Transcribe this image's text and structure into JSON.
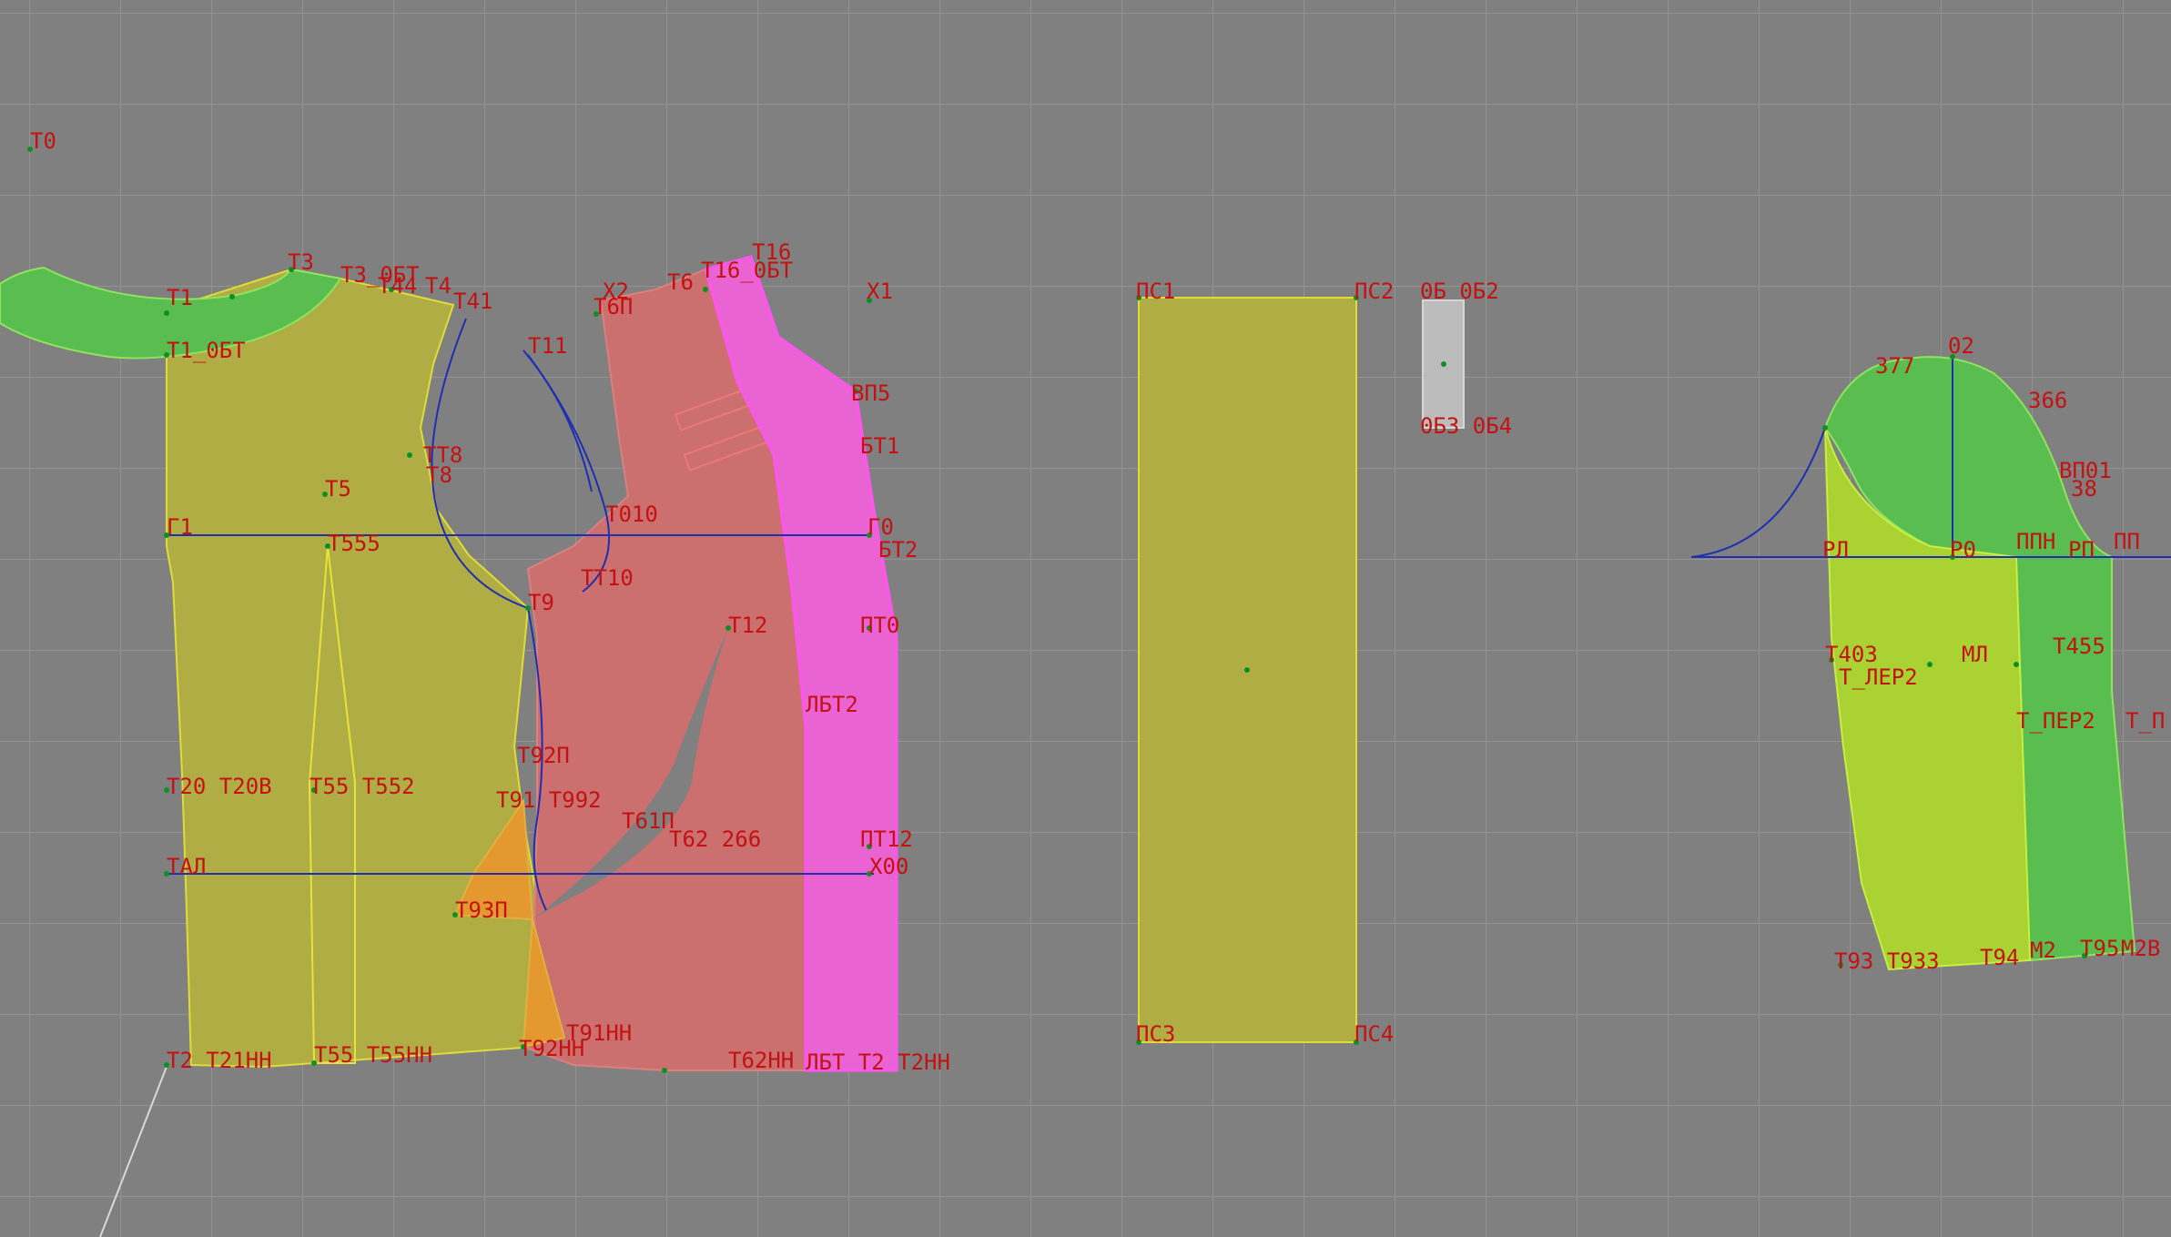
{
  "colors": {
    "background": "#808080",
    "grid": "#939393",
    "label": "#c41111",
    "point": "#0e8f24",
    "construction_line": "#1f2fb0",
    "olive_piece": "#b1ad45",
    "olive_piece_edge": "#dedc39",
    "green_piece": "#59bd4f",
    "green_piece_edge": "#8fe35f",
    "salmon_piece": "#cb6f6f",
    "magenta_piece": "#e964d2",
    "magenta_edge": "#ff55f0",
    "lime_piece": "#a9d232",
    "orange_piece": "#e3992f",
    "grey_piece": "#bcbcbc"
  },
  "labels": {
    "t0": "T0",
    "t1": "T1",
    "t3": "T3",
    "t3_obt": "T3_0БТ",
    "t44": "T44",
    "t4": "T4",
    "t41": "T41",
    "t1_obt": "T1_0БТ",
    "t11": "T11",
    "tt8": "TT8",
    "t8": "T8",
    "t5": "T5",
    "g1": "Г1",
    "t555": "T555",
    "t010": "T010",
    "tt10": "TT10",
    "t9": "T9",
    "t92p": "T92П",
    "t20_t20v": "T20 T20B",
    "t55_t552": "T55 T552",
    "t91_t992": "T91 T992",
    "tal": "TAЛ",
    "t93p": "T93П",
    "t2_t21nn": "T2 T21HH",
    "t55_t55nn": "T55 T55HH",
    "t92nn": "T92HH",
    "t91nn": "T91HH",
    "x2": "X2",
    "t6": "T6",
    "t16": "T16",
    "t16_obt": "T16_0БТ",
    "t6p": "T6П",
    "x1": "X1",
    "vp5": "BП5",
    "bt1": "БT1",
    "g0": "Г0",
    "bt2": "БT2",
    "pt0": "ПT0",
    "t12": "T12",
    "lbt2": "ЛБT2",
    "t61p": "T61П",
    "t62_266": "T62 266",
    "pt12": "ПT12",
    "x00": "X00",
    "t62nn": "T62HH",
    "lbt_t2": "ЛБT T2 T2HH",
    "ps1": "ПС1",
    "ps2": "ПС2",
    "ps3": "ПС3",
    "ps4": "ПС4",
    "ob1_ob2": "0Б 0Б2",
    "ob3_ob4": "0Б3 0Б4",
    "o2": "02",
    "s377": "377",
    "s366": "366",
    "vp01": "BП01",
    "s38": "38",
    "pl": "PЛ",
    "p0": "P0",
    "ppn": "ППН",
    "rp": "PП",
    "pp": "ПП",
    "t403": "T403",
    "ml": "МЛ",
    "t455": "T455",
    "t_ler2": "T_ЛЕР2",
    "t_per2": "T_ПЕР2",
    "t_pr": "T_П",
    "t93_t933": "T93 T933",
    "t94": "T94",
    "m2": "M2",
    "t95": "T95",
    "m2b": "M2B"
  }
}
